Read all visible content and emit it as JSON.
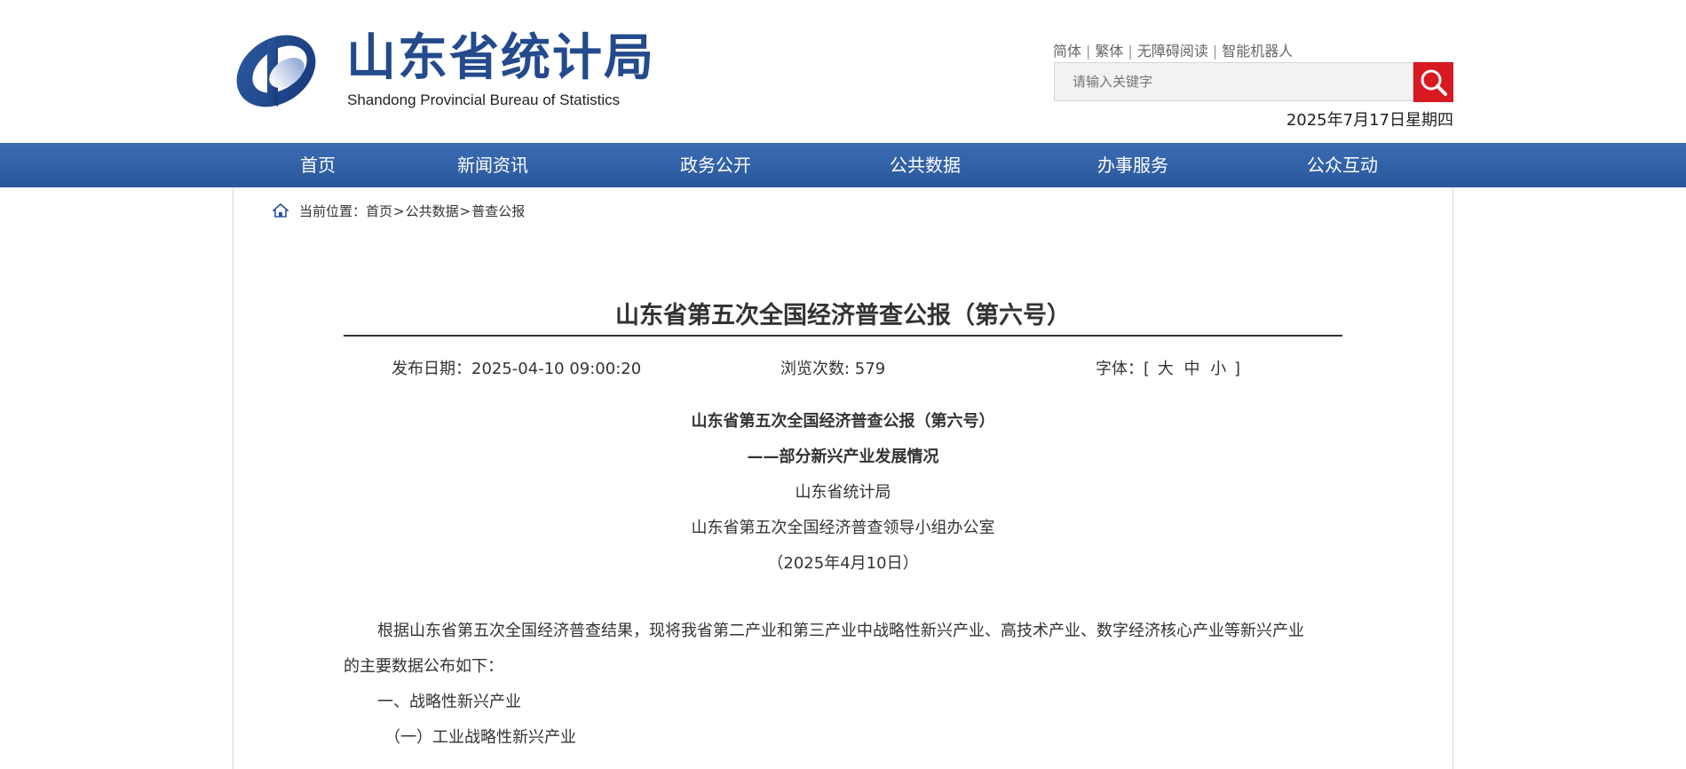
{
  "header": {
    "logo_cn": "山东省统计局",
    "logo_en": "Shandong Provincial Bureau of Statistics",
    "top_links": [
      "简体",
      "繁体",
      "无障碍阅读",
      "智能机器人"
    ],
    "search_placeholder": "请输入关键字",
    "date": "2025年7月17日星期四"
  },
  "nav": {
    "items": [
      "首页",
      "新闻资讯",
      "政务公开",
      "公共数据",
      "办事服务",
      "公众互动"
    ]
  },
  "breadcrumb": {
    "label": "当前位置：",
    "items": [
      "首页",
      "公共数据",
      "普查公报"
    ]
  },
  "article": {
    "title": "山东省第五次全国经济普查公报（第六号）",
    "meta": {
      "publish_date": "发布日期：2025-04-10 09:00:20",
      "views": "浏览次数: 579",
      "font_label": "字体：[",
      "font_large": "大",
      "font_medium": "中",
      "font_small": "小",
      "font_end": "]"
    },
    "header_lines": {
      "heading": "山东省第五次全国经济普查公报（第六号）",
      "subheading": "——部分新兴产业发展情况",
      "issuer1": "山东省统计局",
      "issuer2": "山东省第五次全国经济普查领导小组办公室",
      "date": "（2025年4月10日）"
    },
    "body": {
      "p1_line1": "根据山东省第五次全国经济普查结果，现将我省第二产业和第三产业中战略性新兴产业、高技术产业、数字经济核心产业等新兴产业",
      "p1_line2": "的主要数据公布如下：",
      "section1": "一、战略性新兴产业",
      "section1_1": "（一）工业战略性新兴产业"
    }
  },
  "colors": {
    "brand_blue": "#234a8c",
    "nav_blue": "#2f5fa5",
    "search_red": "#d71921"
  }
}
